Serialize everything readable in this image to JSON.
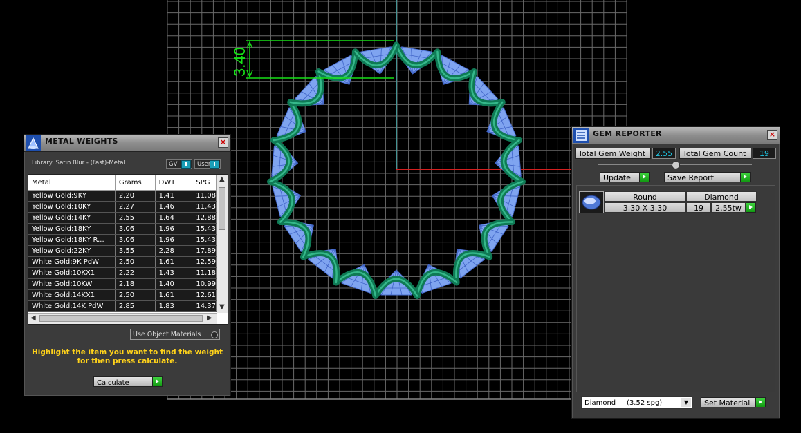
{
  "viewport": {
    "dimension_label": "3.40",
    "colors": {
      "grid": "#6a6a6a",
      "axis_y": "#1fbfbf",
      "axis_x": "#d42020",
      "ring": "#0f7a55",
      "gem": "#7fa4f0",
      "dimension": "#17e017"
    }
  },
  "metal_weights": {
    "title": "METAL WEIGHTS",
    "library": "Library: Satin Blur - (Fast)-Metal",
    "toggle_gv": "GV",
    "toggle_user": "User",
    "columns": [
      "Metal",
      "Grams",
      "DWT",
      "SPG"
    ],
    "rows": [
      [
        "Yellow Gold:9KY",
        "2.20",
        "1.41",
        "11.08"
      ],
      [
        "Yellow Gold:10KY",
        "2.27",
        "1.46",
        "11.43"
      ],
      [
        "Yellow Gold:14KY",
        "2.55",
        "1.64",
        "12.88"
      ],
      [
        "Yellow Gold:18KY",
        "3.06",
        "1.96",
        "15.43"
      ],
      [
        "Yellow Gold:18KY R...",
        "3.06",
        "1.96",
        "15.43"
      ],
      [
        "Yellow Gold:22KY",
        "3.55",
        "2.28",
        "17.89"
      ],
      [
        "White Gold:9K PdW",
        "2.50",
        "1.61",
        "12.59"
      ],
      [
        "White Gold:10KX1",
        "2.22",
        "1.43",
        "11.18"
      ],
      [
        "White Gold:10KW",
        "2.18",
        "1.40",
        "10.99"
      ],
      [
        "White Gold:14KX1",
        "2.50",
        "1.61",
        "12.61"
      ],
      [
        "White Gold:14K PdW",
        "2.85",
        "1.83",
        "14.37"
      ]
    ],
    "use_object_materials": "Use Object Materials",
    "hint_line1": "Highlight the item you want to find the weight",
    "hint_line2": "for then press calculate.",
    "calculate_label": "Calculate"
  },
  "gem_reporter": {
    "title": "GEM REPORTER",
    "total_gem_weight_label": "Total Gem Weight",
    "total_gem_weight": "2.55",
    "total_gem_count_label": "Total Gem Count",
    "total_gem_count": "19",
    "update_label": "Update",
    "save_report_label": "Save Report",
    "gems": [
      {
        "shape": "Round",
        "material": "Diamond",
        "size": "3.30 X 3.30",
        "count": "19",
        "weight": "2.55tw"
      }
    ],
    "material_selected": "Diamond     (3.52 spg)",
    "set_material_label": "Set Material"
  }
}
